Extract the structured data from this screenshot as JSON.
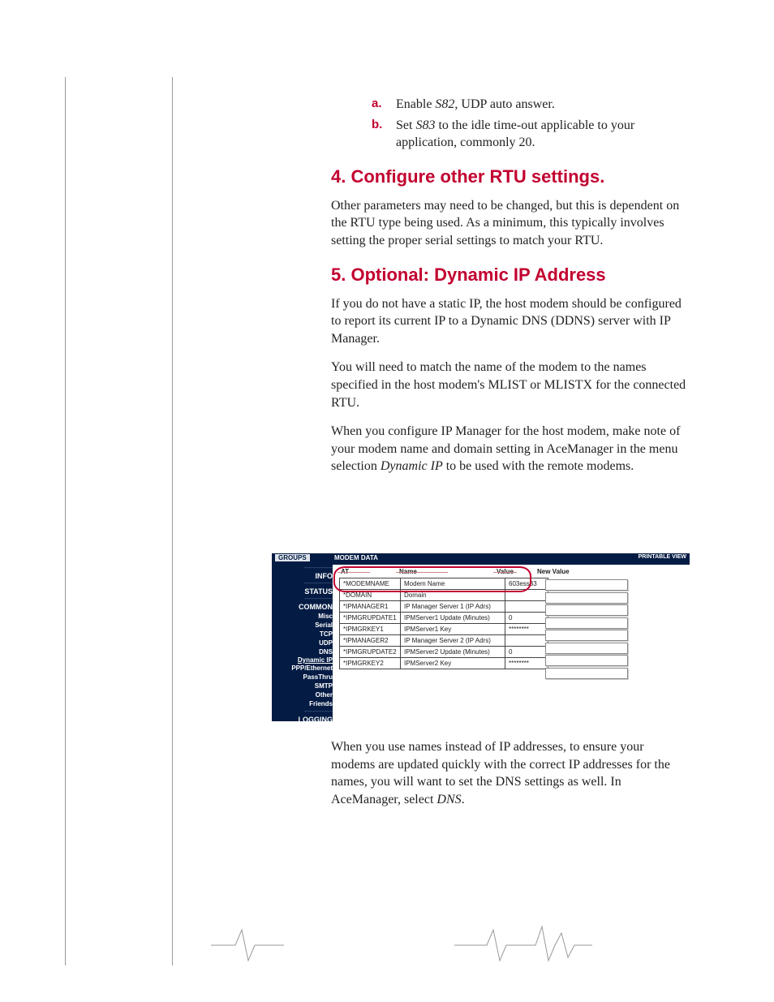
{
  "steps": {
    "a": {
      "marker": "a.",
      "pre": "Enable ",
      "reg": "S82",
      "post": ", UDP auto answer."
    },
    "b": {
      "marker": "b.",
      "pre": "Set ",
      "reg": "S83",
      "post": " to the idle time-out applicable to your application, commonly 20."
    }
  },
  "section4": {
    "title": "4. Configure other RTU settings.",
    "p1": "Other parameters may need to be changed, but this is dependent on the RTU type being used. As a minimum, this typically involves setting the proper serial settings to match your RTU."
  },
  "section5": {
    "title": "5. Optional: Dynamic IP Address",
    "p1": "If you do not have a static IP, the host modem should be configured to report its current IP to a Dynamic DNS (DDNS) server with IP Manager.",
    "p2": "You will need to match the name of the modem to the names specified in the host modem's MLIST or MLISTX for the connected RTU.",
    "p3_a": "When you configure IP Manager for the host modem, make note of your modem name and domain setting in AceManager in the menu selection ",
    "p3_em": "Dynamic IP",
    "p3_b": " to be used with the remote modems.",
    "p4_a": "When you use names instead of IP addresses, to ensure your modems are updated quickly with the correct IP addresses for the names, you will want to set the DNS settings as well. In AceManager, select ",
    "p4_em": "DNS",
    "p4_b": "."
  },
  "shot": {
    "top": {
      "groups": "GROUPS",
      "modem_data": "MODEM DATA",
      "printable": "PRINTABLE VIEW"
    },
    "side": {
      "info": "INFO",
      "status": "STATUS",
      "common": "COMMON",
      "misc": "Misc",
      "serial": "Serial",
      "tcp": "TCP",
      "udp": "UDP",
      "dns": "DNS",
      "dynip": "Dynamic IP",
      "ppp": "PPP/Ethernet",
      "passthru": "PassThru",
      "smtp": "SMTP",
      "other": "Other",
      "friends": "Friends",
      "logging": "LOGGING"
    },
    "headers": {
      "at": "AT",
      "name": "Name",
      "value": "Value",
      "newvalue": "New Value"
    },
    "rows": [
      {
        "at": "*MODEMNAME",
        "name": "Modem Name",
        "value": "603ess33"
      },
      {
        "at": "*DOMAIN",
        "name": "Domain",
        "value": ""
      },
      {
        "at": "*IPMANAGER1",
        "name": "IP Manager Server 1 (IP Adrs)",
        "value": ""
      },
      {
        "at": "*IPMGRUPDATE1",
        "name": "IPMServer1 Update (Minutes)",
        "value": "0"
      },
      {
        "at": "*IPMGRKEY1",
        "name": "IPMServer1 Key",
        "value": "********"
      },
      {
        "at": "*IPMANAGER2",
        "name": "IP Manager Server 2 (IP Adrs)",
        "value": ""
      },
      {
        "at": "*IPMGRUPDATE2",
        "name": "IPMServer2 Update (Minutes)",
        "value": "0"
      },
      {
        "at": "*IPMGRKEY2",
        "name": "IPMServer2 Key",
        "value": "********"
      }
    ]
  }
}
